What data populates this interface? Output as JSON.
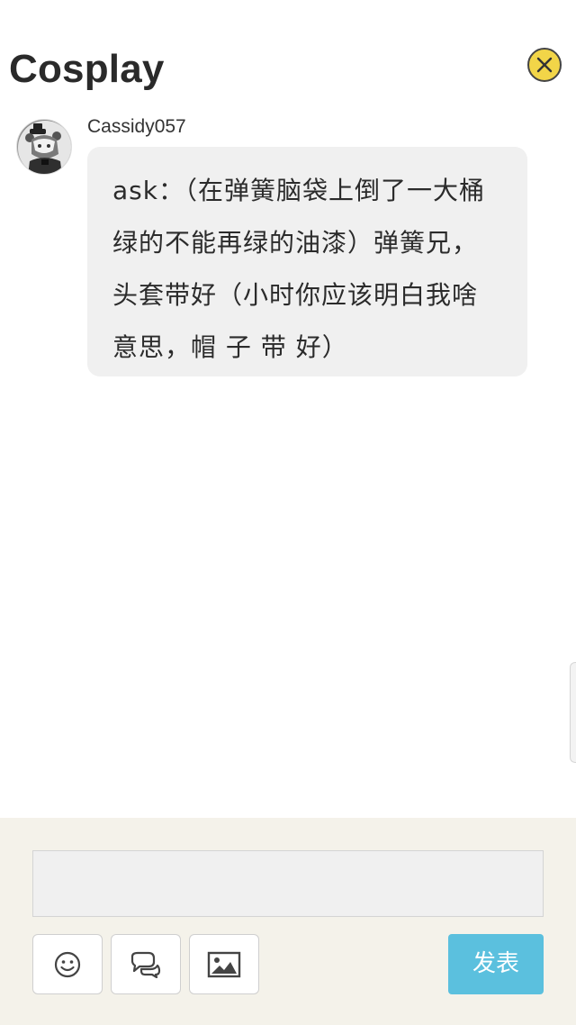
{
  "header": {
    "title": "Cosplay",
    "close_icon": "close-icon"
  },
  "post": {
    "username": "Cassidy057",
    "avatar_icon": "avatar",
    "message": "ask：（在弹簧脑袋上倒了一大桶绿的不能再绿的油漆）弹簧兄，头套带好（小时你应该明白我啥意思，帽 子 带 好）"
  },
  "composer": {
    "input_value": "",
    "input_placeholder": "",
    "tools": [
      {
        "icon": "smiley-icon"
      },
      {
        "icon": "chat-bubbles-icon"
      },
      {
        "icon": "image-icon"
      }
    ],
    "submit_label": "发表",
    "submit_color": "#5bc0de",
    "background_color": "#f4f2ea"
  }
}
